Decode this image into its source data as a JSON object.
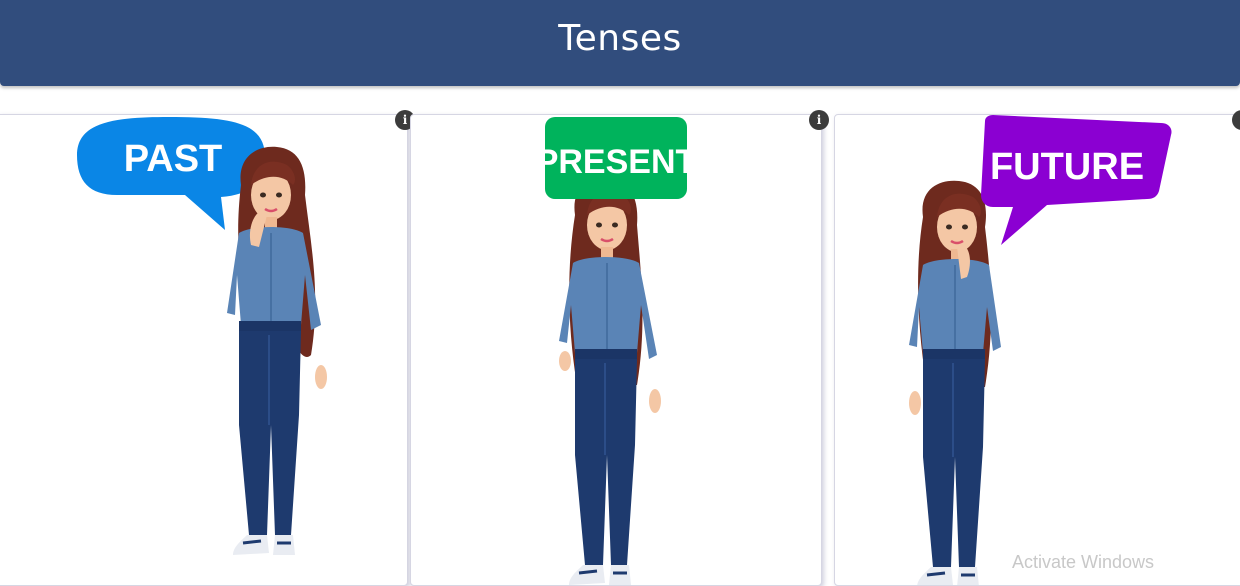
{
  "header": {
    "title": "Tenses"
  },
  "cards": [
    {
      "bubble_text": "PAST",
      "bubble_color": "#0a86e6"
    },
    {
      "bubble_text": "PRESENT",
      "bubble_color": "#00b35c"
    },
    {
      "bubble_text": "FUTURE",
      "bubble_color": "#8b00d2"
    }
  ],
  "info_icon": "i",
  "watermark": "Activate Windows",
  "colors": {
    "header_bg": "#314d7d",
    "shirt": "#5a84b6",
    "jeans": "#1e3a6e",
    "hair": "#6e2a1e"
  }
}
